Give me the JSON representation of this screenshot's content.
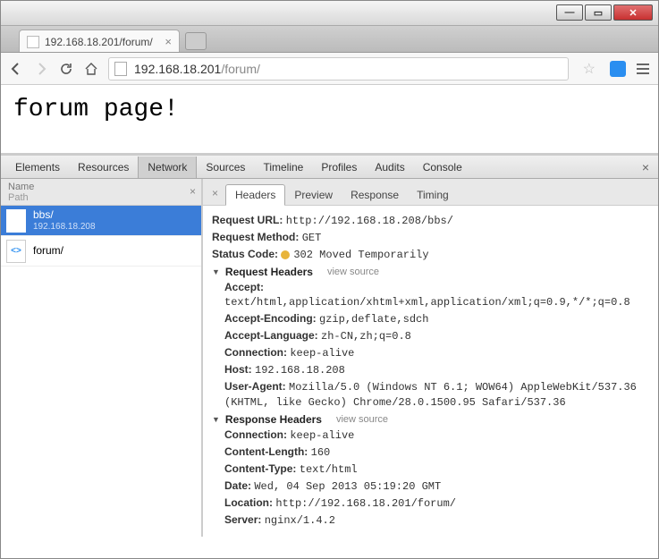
{
  "window": {
    "tab_title": "192.168.18.201/forum/"
  },
  "navbar": {
    "url_host": "192.168.18.201",
    "url_path": "/forum/"
  },
  "page": {
    "heading": "forum page!"
  },
  "devtools": {
    "tabs": [
      "Elements",
      "Resources",
      "Network",
      "Sources",
      "Timeline",
      "Profiles",
      "Audits",
      "Console"
    ],
    "active_tab": "Network",
    "left": {
      "col1": "Name",
      "col2": "Path",
      "requests": [
        {
          "name": "bbs/",
          "path": "192.168.18.208",
          "icon": "doc",
          "selected": true
        },
        {
          "name": "forum/",
          "path": "",
          "icon": "html",
          "selected": false
        }
      ]
    },
    "sub_tabs": [
      "Headers",
      "Preview",
      "Response",
      "Timing"
    ],
    "active_sub_tab": "Headers",
    "details": {
      "request_url_label": "Request URL:",
      "request_url": "http://192.168.18.208/bbs/",
      "request_method_label": "Request Method:",
      "request_method": "GET",
      "status_code_label": "Status Code:",
      "status_code": "302 Moved Temporarily",
      "req_headers_title": "Request Headers",
      "resp_headers_title": "Response Headers",
      "view_source": "view source",
      "request_headers": [
        {
          "k": "Accept:",
          "v": "text/html,application/xhtml+xml,application/xml;q=0.9,*/*;q=0.8"
        },
        {
          "k": "Accept-Encoding:",
          "v": "gzip,deflate,sdch"
        },
        {
          "k": "Accept-Language:",
          "v": "zh-CN,zh;q=0.8"
        },
        {
          "k": "Connection:",
          "v": "keep-alive"
        },
        {
          "k": "Host:",
          "v": "192.168.18.208"
        },
        {
          "k": "User-Agent:",
          "v": "Mozilla/5.0 (Windows NT 6.1; WOW64) AppleWebKit/537.36 (KHTML, like Gecko) Chrome/28.0.1500.95 Safari/537.36"
        }
      ],
      "response_headers": [
        {
          "k": "Connection:",
          "v": "keep-alive"
        },
        {
          "k": "Content-Length:",
          "v": "160"
        },
        {
          "k": "Content-Type:",
          "v": "text/html"
        },
        {
          "k": "Date:",
          "v": "Wed, 04 Sep 2013 05:19:20 GMT"
        },
        {
          "k": "Location:",
          "v": "http://192.168.18.201/forum/"
        },
        {
          "k": "Server:",
          "v": "nginx/1.4.2"
        }
      ]
    }
  }
}
